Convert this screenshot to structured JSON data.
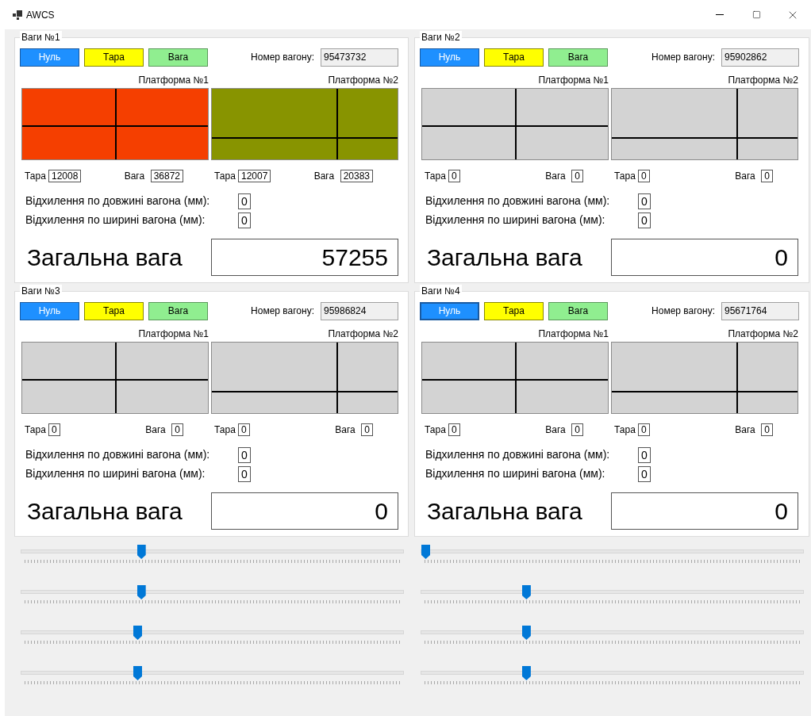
{
  "window": {
    "title": "AWCS"
  },
  "scales": [
    {
      "title": "Ваги №1",
      "buttons": [
        {
          "label": "Нуль",
          "kind": "zero",
          "focused": false
        },
        {
          "label": "Тара",
          "kind": "tare",
          "focused": false
        },
        {
          "label": "Вага",
          "kind": "weight",
          "focused": false
        }
      ],
      "wagon_label": "Номер вагону:",
      "wagon_number": "95473732",
      "platforms": [
        {
          "title": "Платформа №1",
          "color": "#f53f00",
          "kind": "center",
          "tare_label": "Тара",
          "tare": "12008",
          "weight_label": "Вага",
          "weight": "36872"
        },
        {
          "title": "Платформа №2",
          "color": "#889400",
          "kind": "offset",
          "tare_label": "Тара",
          "tare": "12007",
          "weight_label": "Вага",
          "weight": "20383"
        }
      ],
      "deviations": [
        {
          "label": "Відхилення по довжині вагона (мм):",
          "value": "0"
        },
        {
          "label": "Відхилення по ширині вагона (мм):",
          "value": "0"
        }
      ],
      "total_label": "Загальна вага",
      "total": "57255"
    },
    {
      "title": "Ваги №2",
      "buttons": [
        {
          "label": "Нуль",
          "kind": "zero",
          "focused": false
        },
        {
          "label": "Тара",
          "kind": "tare",
          "focused": false
        },
        {
          "label": "Вага",
          "kind": "weight",
          "focused": false
        }
      ],
      "wagon_label": "Номер вагону:",
      "wagon_number": "95902862",
      "platforms": [
        {
          "title": "Платформа №1",
          "color": "#d3d3d3",
          "kind": "center",
          "tare_label": "Тара",
          "tare": "0",
          "weight_label": "Вага",
          "weight": "0"
        },
        {
          "title": "Платформа №2",
          "color": "#d3d3d3",
          "kind": "offset",
          "tare_label": "Тара",
          "tare": "0",
          "weight_label": "Вага",
          "weight": "0"
        }
      ],
      "deviations": [
        {
          "label": "Відхилення по довжині вагона (мм):",
          "value": "0"
        },
        {
          "label": "Відхилення по ширині вагона (мм):",
          "value": "0"
        }
      ],
      "total_label": "Загальна вага",
      "total": "0"
    },
    {
      "title": "Ваги №3",
      "buttons": [
        {
          "label": "Нуль",
          "kind": "zero",
          "focused": false
        },
        {
          "label": "Тара",
          "kind": "tare",
          "focused": false
        },
        {
          "label": "Вага",
          "kind": "weight",
          "focused": false
        }
      ],
      "wagon_label": "Номер вагону:",
      "wagon_number": "95986824",
      "platforms": [
        {
          "title": "Платформа №1",
          "color": "#d3d3d3",
          "kind": "center",
          "tare_label": "Тара",
          "tare": "0",
          "weight_label": "Вага",
          "weight": "0"
        },
        {
          "title": "Платформа №2",
          "color": "#d3d3d3",
          "kind": "offset",
          "tare_label": "Тара",
          "tare": "0",
          "weight_label": "Вага",
          "weight": "0"
        }
      ],
      "deviations": [
        {
          "label": "Відхилення по довжині вагона (мм):",
          "value": "0"
        },
        {
          "label": "Відхилення по ширині вагона (мм):",
          "value": "0"
        }
      ],
      "total_label": "Загальна вага",
      "total": "0"
    },
    {
      "title": "Ваги №4",
      "buttons": [
        {
          "label": "Нуль",
          "kind": "zero",
          "focused": true
        },
        {
          "label": "Тара",
          "kind": "tare",
          "focused": false
        },
        {
          "label": "Вага",
          "kind": "weight",
          "focused": false
        }
      ],
      "wagon_label": "Номер вагону:",
      "wagon_number": "95671764",
      "platforms": [
        {
          "title": "Платформа №1",
          "color": "#d3d3d3",
          "kind": "center",
          "tare_label": "Тара",
          "tare": "0",
          "weight_label": "Вага",
          "weight": "0"
        },
        {
          "title": "Платформа №2",
          "color": "#d3d3d3",
          "kind": "offset",
          "tare_label": "Тара",
          "tare": "0",
          "weight_label": "Вага",
          "weight": "0"
        }
      ],
      "deviations": [
        {
          "label": "Відхилення по довжині вагона (мм):",
          "value": "0"
        },
        {
          "label": "Відхилення по ширині вагона (мм):",
          "value": "0"
        }
      ],
      "total_label": "Загальна вага",
      "total": "0"
    }
  ],
  "sliders": [
    {
      "level": 0.31
    },
    {
      "level": 0.0
    },
    {
      "level": 0.31
    },
    {
      "level": 0.27
    },
    {
      "level": 0.3
    },
    {
      "level": 0.27
    },
    {
      "level": 0.3
    },
    {
      "level": 0.27
    }
  ]
}
